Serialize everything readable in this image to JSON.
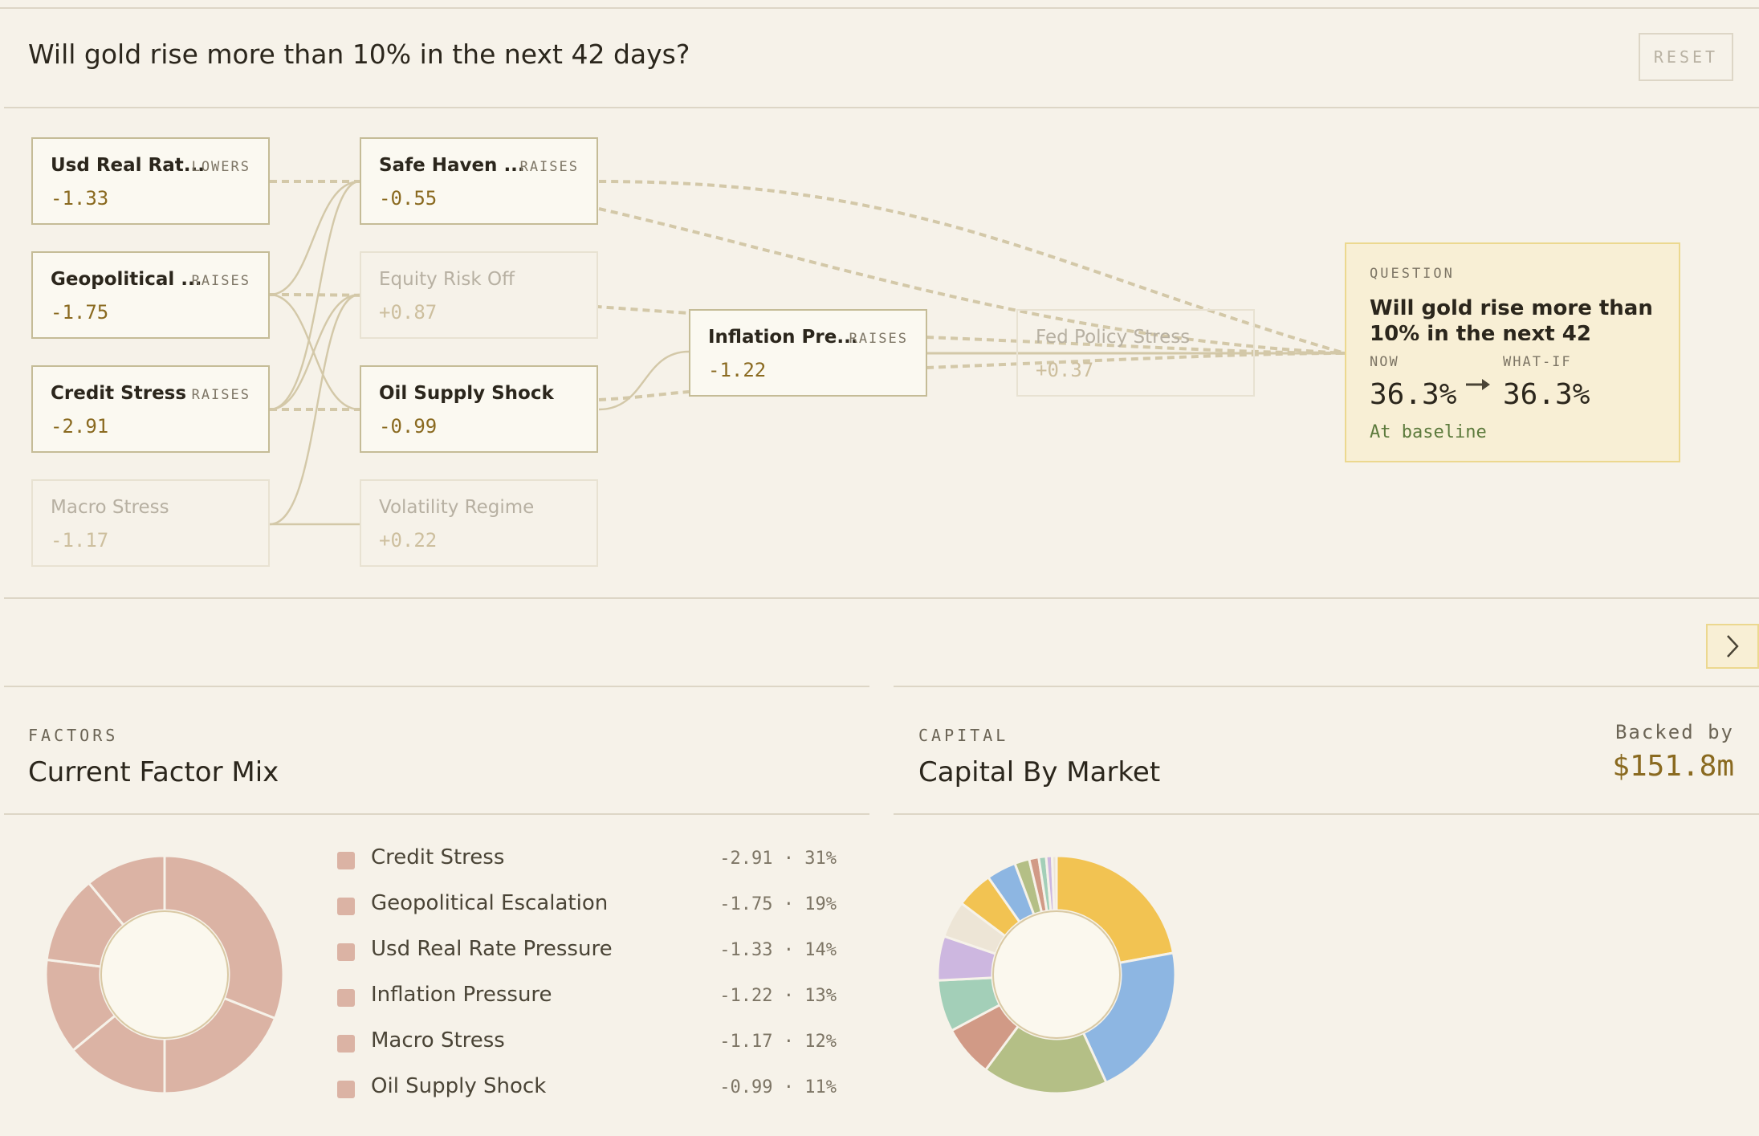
{
  "header": {
    "title": "Will gold rise more than 10% in the next 42 days?",
    "reset_label": "RESET"
  },
  "graph": {
    "nodes": [
      {
        "id": "usd",
        "label": "Usd Real Rat...",
        "direction": "LOWERS",
        "value": "-1.33",
        "active": true
      },
      {
        "id": "geo",
        "label": "Geopolitical ...",
        "direction": "RAISES",
        "value": "-1.75",
        "active": true
      },
      {
        "id": "credit",
        "label": "Credit Stress",
        "direction": "RAISES",
        "value": "-2.91",
        "active": true
      },
      {
        "id": "macro",
        "label": "Macro Stress",
        "direction": "",
        "value": "-1.17",
        "active": false
      },
      {
        "id": "safe",
        "label": "Safe Haven ...",
        "direction": "RAISES",
        "value": "-0.55",
        "active": true
      },
      {
        "id": "equity",
        "label": "Equity Risk Off",
        "direction": "",
        "value": "+0.87",
        "active": false
      },
      {
        "id": "oil",
        "label": "Oil Supply Shock",
        "direction": "",
        "value": "-0.99",
        "active": true
      },
      {
        "id": "vol",
        "label": "Volatility Regime",
        "direction": "",
        "value": "+0.22",
        "active": false
      },
      {
        "id": "infl",
        "label": "Inflation Pre...",
        "direction": "RAISES",
        "value": "-1.22",
        "active": true
      },
      {
        "id": "fed",
        "label": "Fed Policy Stress",
        "direction": "",
        "value": "+0.37",
        "active": false
      }
    ]
  },
  "question_card": {
    "label": "QUESTION",
    "text": "Will gold rise more than 10% in the next 42 days?",
    "now_label": "NOW",
    "whatif_label": "WHAT-IF",
    "now_value": "36.3%",
    "whatif_value": "36.3%",
    "status": "At baseline"
  },
  "factors": {
    "section_label": "FACTORS",
    "title": "Current Factor Mix",
    "color": "#dbb3a4",
    "items": [
      {
        "name": "Credit Stress",
        "value": "-2.91",
        "share": "31%"
      },
      {
        "name": "Geopolitical Escalation",
        "value": "-1.75",
        "share": "19%"
      },
      {
        "name": "Usd Real Rate Pressure",
        "value": "-1.33",
        "share": "14%"
      },
      {
        "name": "Inflation Pressure",
        "value": "-1.22",
        "share": "13%"
      },
      {
        "name": "Macro Stress",
        "value": "-1.17",
        "share": "12%"
      },
      {
        "name": "Oil Supply Shock",
        "value": "-0.99",
        "share": "11%"
      }
    ]
  },
  "capital": {
    "section_label": "CAPITAL",
    "title": "Capital By Market",
    "backed_label": "Backed by",
    "backed_value": "$151.8m"
  },
  "chart_data": [
    {
      "type": "pie",
      "values": [
        31,
        19,
        14,
        13,
        12,
        11
      ],
      "categories": [
        "Credit Stress",
        "Geopolitical Escalation",
        "Usd Real Rate Pressure",
        "Inflation Pressure",
        "Macro Stress",
        "Oil Supply Shock"
      ],
      "colors": [
        "#dbb3a4",
        "#dbb3a4",
        "#dbb3a4",
        "#dbb3a4",
        "#dbb3a4",
        "#dbb3a4"
      ]
    },
    {
      "type": "pie",
      "values": [
        22,
        21,
        17,
        7,
        7,
        6,
        5,
        5,
        4,
        2.0,
        1.3,
        1.0,
        0.8,
        0.6
      ],
      "colors": [
        "#f2c352",
        "#8db6e2",
        "#b4bf86",
        "#d19a86",
        "#a3cfb8",
        "#cdb7e0",
        "#ede5d6",
        "#f2c352",
        "#8db6e2",
        "#b4bf86",
        "#d19a86",
        "#a3cfb8",
        "#cdb7e0",
        "#ede5d6"
      ]
    }
  ]
}
